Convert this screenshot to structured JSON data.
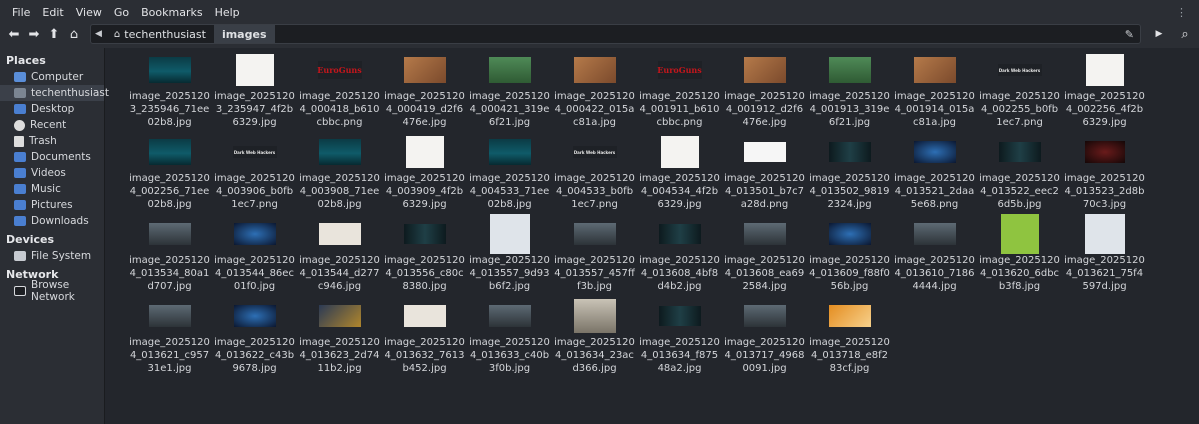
{
  "menu": [
    "File",
    "Edit",
    "View",
    "Go",
    "Bookmarks",
    "Help"
  ],
  "breadcrumbs": [
    {
      "label": "techenthusiast",
      "active": false
    },
    {
      "label": "images",
      "active": true
    }
  ],
  "sidebar": {
    "sections": [
      {
        "heading": "Places",
        "items": [
          {
            "label": "Computer",
            "icon": "computer-icon"
          },
          {
            "label": "techenthusiast",
            "icon": "home-folder-icon",
            "selected": true
          },
          {
            "label": "Desktop",
            "icon": "desktop-icon"
          },
          {
            "label": "Recent",
            "icon": "recent-icon"
          },
          {
            "label": "Trash",
            "icon": "trash-icon"
          },
          {
            "label": "Documents",
            "icon": "documents-icon"
          },
          {
            "label": "Videos",
            "icon": "videos-icon"
          },
          {
            "label": "Music",
            "icon": "music-icon"
          },
          {
            "label": "Pictures",
            "icon": "pictures-icon"
          },
          {
            "label": "Downloads",
            "icon": "downloads-icon"
          }
        ]
      },
      {
        "heading": "Devices",
        "items": [
          {
            "label": "File System",
            "icon": "drive-icon"
          }
        ]
      },
      {
        "heading": "Network",
        "items": [
          {
            "label": "Browse Network",
            "icon": "network-icon"
          }
        ]
      }
    ]
  },
  "files": [
    {
      "name": "image_20251203_235946_71ee02b8.jpg",
      "thumb": "hacker"
    },
    {
      "name": "image_20251203_235947_4f2b6329.jpg",
      "thumb": "cowboy"
    },
    {
      "name": "image_20251204_000418_b610cbbc.png",
      "thumb": "euro",
      "thumb_text": "EuroGuns"
    },
    {
      "name": "image_20251204_000419_d2f6476e.jpg",
      "thumb": "gunbox"
    },
    {
      "name": "image_20251204_000421_319e6f21.jpg",
      "thumb": "pistol"
    },
    {
      "name": "image_20251204_000422_015ac81a.jpg",
      "thumb": "gunbox"
    },
    {
      "name": "image_20251204_001911_b610cbbc.png",
      "thumb": "euro",
      "thumb_text": "EuroGuns"
    },
    {
      "name": "image_20251204_001912_d2f6476e.jpg",
      "thumb": "gunbox"
    },
    {
      "name": "image_20251204_001913_319e6f21.jpg",
      "thumb": "pistol"
    },
    {
      "name": "image_20251204_001914_015ac81a.jpg",
      "thumb": "gunbox"
    },
    {
      "name": "image_20251204_002255_b0fb1ec7.png",
      "thumb": "darkweb",
      "thumb_text": "Dark Web Hackers"
    },
    {
      "name": "image_20251204_002256_4f2b6329.jpg",
      "thumb": "cowboy"
    },
    {
      "name": "image_20251204_002256_71ee02b8.jpg",
      "thumb": "hacker"
    },
    {
      "name": "image_20251204_003906_b0fb1ec7.png",
      "thumb": "darkweb",
      "thumb_text": "Dark Web Hackers"
    },
    {
      "name": "image_20251204_003908_71ee02b8.jpg",
      "thumb": "hacker"
    },
    {
      "name": "image_20251204_003909_4f2b6329.jpg",
      "thumb": "cowboy"
    },
    {
      "name": "image_20251204_004533_71ee02b8.jpg",
      "thumb": "hacker"
    },
    {
      "name": "image_20251204_004533_b0fb1ec7.png",
      "thumb": "darkweb",
      "thumb_text": "Dark Web Hackers"
    },
    {
      "name": "image_20251204_004534_4f2b6329.jpg",
      "thumb": "cowboy"
    },
    {
      "name": "image_20251204_013501_b7c7a28d.png",
      "thumb": "house"
    },
    {
      "name": "image_20251204_013502_98192324.jpg",
      "thumb": "dark"
    },
    {
      "name": "image_20251204_013521_2daa5e68.png",
      "thumb": "bluenet"
    },
    {
      "name": "image_20251204_013522_eec26d5b.jpg",
      "thumb": "dark"
    },
    {
      "name": "image_20251204_013523_2d8b70c3.jpg",
      "thumb": "red"
    },
    {
      "name": "image_20251204_013534_80a1d707.jpg",
      "thumb": "office"
    },
    {
      "name": "image_20251204_013544_86ec01f0.jpg",
      "thumb": "bluenet"
    },
    {
      "name": "image_20251204_013544_d277c946.jpg",
      "thumb": "stats"
    },
    {
      "name": "image_20251204_013556_c80c8380.jpg",
      "thumb": "dark"
    },
    {
      "name": "image_20251204_013557_9d93b6f2.jpg",
      "thumb": "social"
    },
    {
      "name": "image_20251204_013557_457fff3b.jpg",
      "thumb": "office"
    },
    {
      "name": "image_20251204_013608_4bf8d4b2.jpg",
      "thumb": "dark"
    },
    {
      "name": "image_20251204_013608_ea692584.jpg",
      "thumb": "office"
    },
    {
      "name": "image_20251204_013609_f88f056b.jpg",
      "thumb": "bluenet"
    },
    {
      "name": "image_20251204_013610_71864444.jpg",
      "thumb": "office"
    },
    {
      "name": "image_20251204_013620_6dbcb3f8.jpg",
      "thumb": "book"
    },
    {
      "name": "image_20251204_013621_75f4597d.jpg",
      "thumb": "social"
    },
    {
      "name": "image_20251204_013621_c95731e1.jpg",
      "thumb": "office"
    },
    {
      "name": "image_20251204_013622_c43b9678.jpg",
      "thumb": "bluenet"
    },
    {
      "name": "image_20251204_013623_2d7411b2.jpg",
      "thumb": "crypto"
    },
    {
      "name": "image_20251204_013632_7613b452.jpg",
      "thumb": "stats"
    },
    {
      "name": "image_20251204_013633_c40b3f0b.jpg",
      "thumb": "office"
    },
    {
      "name": "image_20251204_013634_23acd366.jpg",
      "thumb": "photo"
    },
    {
      "name": "image_20251204_013634_f87548a2.jpg",
      "thumb": "dark"
    },
    {
      "name": "image_20251204_013717_49680091.jpg",
      "thumb": "office"
    },
    {
      "name": "image_20251204_013718_e8f283cf.jpg",
      "thumb": "orange"
    }
  ]
}
